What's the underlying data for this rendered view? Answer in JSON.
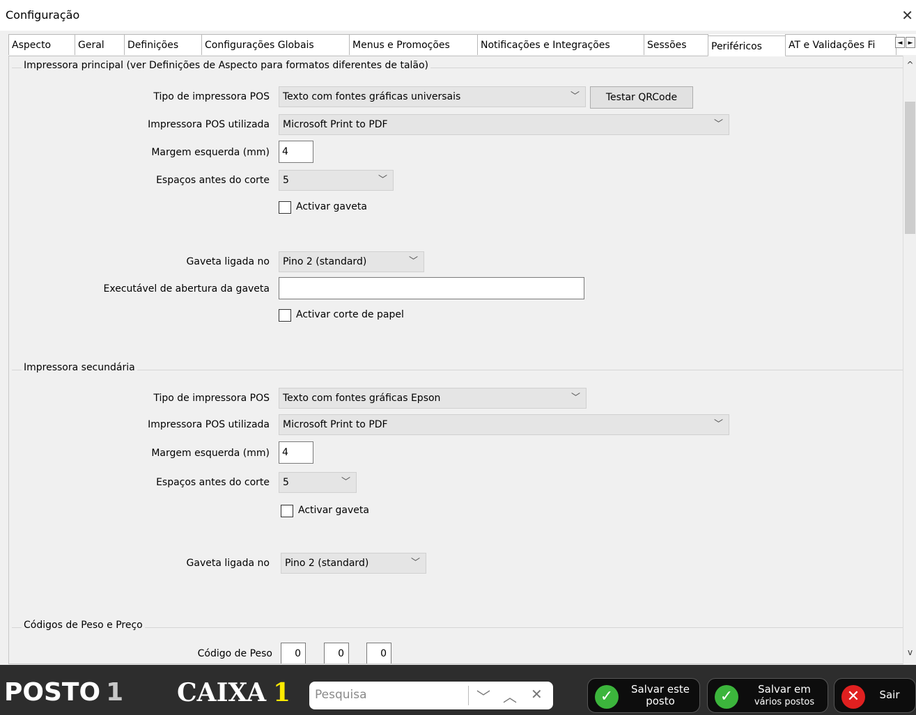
{
  "window": {
    "title": "Configuração",
    "close_symbol": "✕"
  },
  "tabs": [
    {
      "label": "Aspecto"
    },
    {
      "label": "Geral"
    },
    {
      "label": "Definições"
    },
    {
      "label": "Configurações Globais"
    },
    {
      "label": "Menus e Promoções"
    },
    {
      "label": "Notificações e Integrações"
    },
    {
      "label": "Sessões"
    },
    {
      "label": "Periféricos",
      "active": true
    },
    {
      "label": "AT e Validações Fi"
    }
  ],
  "tab_scroll": {
    "left": "◄",
    "right": "►"
  },
  "primary": {
    "legend": "Impressora principal (ver Definições de Aspecto para formatos diferentes de talão)",
    "tipo_label": "Tipo de impressora POS",
    "tipo_value": "Texto com fontes gráficas universais",
    "test_button": "Testar QRCode",
    "impressora_label": "Impressora POS utilizada",
    "impressora_value": "Microsoft Print to PDF",
    "margem_label": "Margem esquerda (mm)",
    "margem_value": "4",
    "espacos_label": "Espaços antes do corte",
    "espacos_value": "5",
    "gaveta_checkbox": "Activar gaveta",
    "gaveta_ligada_label": "Gaveta ligada no",
    "gaveta_ligada_value": "Pino 2 (standard)",
    "executavel_label": "Executável de abertura da gaveta",
    "executavel_value": "",
    "corte_checkbox": "Activar corte de papel"
  },
  "secondary": {
    "legend": "Impressora secundária",
    "tipo_label": "Tipo de impressora POS",
    "tipo_value": "Texto com fontes gráficas Epson",
    "impressora_label": "Impressora POS utilizada",
    "impressora_value": "Microsoft Print to PDF",
    "margem_label": "Margem esquerda (mm)",
    "margem_value": "4",
    "espacos_label": "Espaços antes do corte",
    "espacos_value": "5",
    "gaveta_checkbox": "Activar gaveta",
    "gaveta_ligada_label": "Gaveta ligada no",
    "gaveta_ligada_value": "Pino 2 (standard)"
  },
  "codigos": {
    "legend": "Códigos de Peso e Preço",
    "peso_label": "Código de Peso",
    "peso_values": [
      "0",
      "0",
      "0"
    ]
  },
  "footer": {
    "posto_label": "POSTO",
    "posto_number": "1",
    "caixa_label": "CAIXA",
    "caixa_number": "1",
    "search_placeholder": "Pesquisa",
    "salvar_este_line1": "Salvar este",
    "salvar_este_line2": "posto",
    "salvar_varios_line1": "Salvar em",
    "salvar_varios_line2": "vários postos",
    "sair": "Sair"
  },
  "colors": {
    "accent_green": "#3cb53c",
    "exit_red": "#e02020",
    "caixa_number": "#ffea00"
  }
}
